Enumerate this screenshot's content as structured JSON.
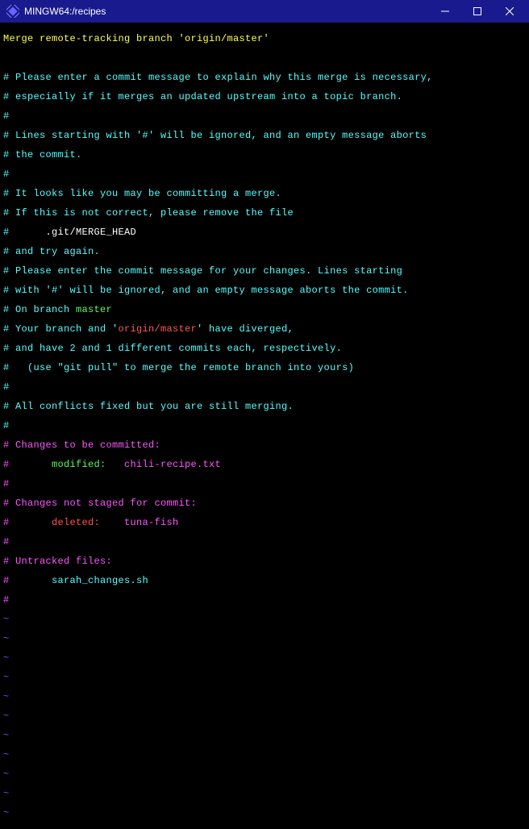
{
  "titlebar": {
    "title": "MINGW64:/recipes"
  },
  "editor": {
    "commit_message": "Merge remote-tracking branch 'origin/master'",
    "comments": {
      "hash": "#",
      "line1": "# Please enter a commit message to explain why this merge is necessary,",
      "line2": "# especially if it merges an updated upstream into a topic branch.",
      "line3": "# Lines starting with '#' will be ignored, and an empty message aborts",
      "line4": "# the commit.",
      "line5": "# It looks like you may be committing a merge.",
      "line6": "# If this is not correct, please remove the file",
      "line7_prefix": "#      ",
      "line7_path": ".git/MERGE_HEAD",
      "line8": "# and try again.",
      "line9": "# Please enter the commit message for your changes. Lines starting",
      "line10": "# with '#' will be ignored, and an empty message aborts the commit.",
      "line11_prefix": "# On branch ",
      "line11_branch": "master",
      "line12_prefix": "# Your branch and '",
      "line12_remote": "origin/master",
      "line12_suffix": "' have diverged,",
      "line13": "# and have 2 and 1 different commits each, respectively.",
      "line14": "#   (use \"git pull\" to merge the remote branch into yours)",
      "line15": "# All conflicts fixed but you are still merging.",
      "line16": "# Changes to be committed:",
      "line17_prefix": "#       ",
      "line17_status": "modified:   ",
      "line17_file": "chili-recipe.txt",
      "line18": "# Changes not staged for commit:",
      "line19_prefix": "#       ",
      "line19_status": "deleted:    ",
      "line19_file": "tuna-fish",
      "line20": "# Untracked files:",
      "line21_prefix": "#       ",
      "line21_file": "sarah_changes.sh"
    },
    "tilde": "~"
  }
}
